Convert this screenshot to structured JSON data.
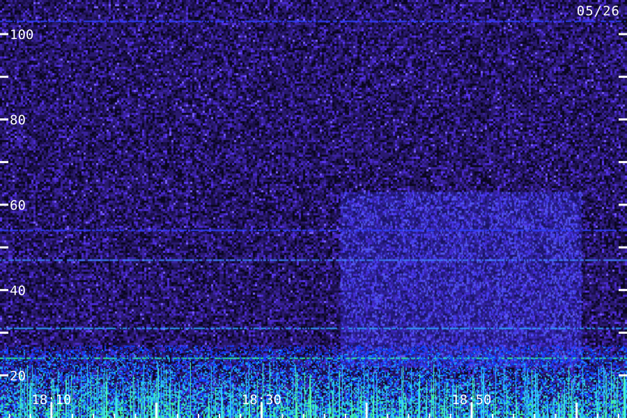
{
  "date_label": "05/26",
  "chart_data": {
    "type": "heatmap",
    "title": "",
    "xlabel": "",
    "ylabel": "",
    "x_tick_labels": [
      "18:10",
      "18:30",
      "18:50"
    ],
    "x_label_times_min": [
      10,
      30,
      50
    ],
    "x_major_ticks_min": [
      10,
      20,
      30,
      40,
      50,
      60
    ],
    "x_minor_step_min": 2,
    "xlim_min": [
      5.1,
      64.8
    ],
    "y_tick_labels": [
      "20",
      "40",
      "60",
      "80",
      "100"
    ],
    "y_tick_values": [
      20,
      40,
      60,
      80,
      100
    ],
    "y_unlabeled_ticks": [
      30,
      50,
      70,
      90
    ],
    "ylim": [
      10,
      108
    ],
    "background_color": "#2a1a70",
    "noise_palette": [
      "#0a0620",
      "#1a0f4a",
      "#2a1a70",
      "#3a22a0",
      "#4a2ad0",
      "#5a38f0",
      "#7a60ff"
    ],
    "low_band_palette": [
      "#1040ff",
      "#20a0ff",
      "#30e0e0",
      "#40ff80"
    ],
    "emission_block": {
      "start_min": 37.5,
      "end_min": 60.5,
      "ymin": 22,
      "ymax": 63,
      "color": "#3a30e0"
    },
    "horizontal_lines": [
      {
        "y": 103,
        "color": "#3040ff"
      },
      {
        "y": 54,
        "color": "#3040ff"
      },
      {
        "y": 47,
        "color": "#4080ff"
      },
      {
        "y": 31,
        "color": "#30a0ff"
      },
      {
        "y": 24,
        "color": "#30ffa0"
      }
    ]
  }
}
